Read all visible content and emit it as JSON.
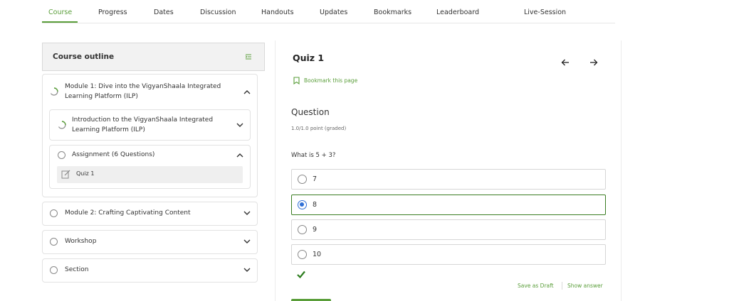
{
  "tabs": [
    {
      "label": "Course",
      "active": true
    },
    {
      "label": "Progress"
    },
    {
      "label": "Dates"
    },
    {
      "label": "Discussion"
    },
    {
      "label": "Handouts"
    },
    {
      "label": "Updates"
    },
    {
      "label": "Bookmarks"
    },
    {
      "label": "Leaderboard"
    },
    {
      "label": "Live-Session"
    }
  ],
  "sidebar": {
    "title": "Course outline",
    "module1": {
      "title": "Module 1: Dive into the VigyanShaala Integrated Learning Platform (ILP)",
      "subsection1": "Introduction to the VigyanShaala Integrated Learning Platform (ILP)",
      "subsection2": "Assignment (6 Questions)",
      "unit": "Quiz 1"
    },
    "module2": "Module 2: Crafting Captivating Content",
    "workshop": "Workshop",
    "section": "Section"
  },
  "main": {
    "title": "Quiz 1",
    "bookmark_label": "Bookmark this page",
    "question_heading": "Question",
    "points": "1.0/1.0 point (graded)",
    "question_text": "What is 5 + 3?",
    "options": [
      "7",
      "8",
      "9",
      "10"
    ],
    "selected_option": "8",
    "save_draft": "Save as Draft",
    "show_answer": "Show answer"
  },
  "colors": {
    "accent": "#5a9e3a",
    "selected_border": "#3a7d22",
    "radio_checked": "#2f6fd6"
  }
}
